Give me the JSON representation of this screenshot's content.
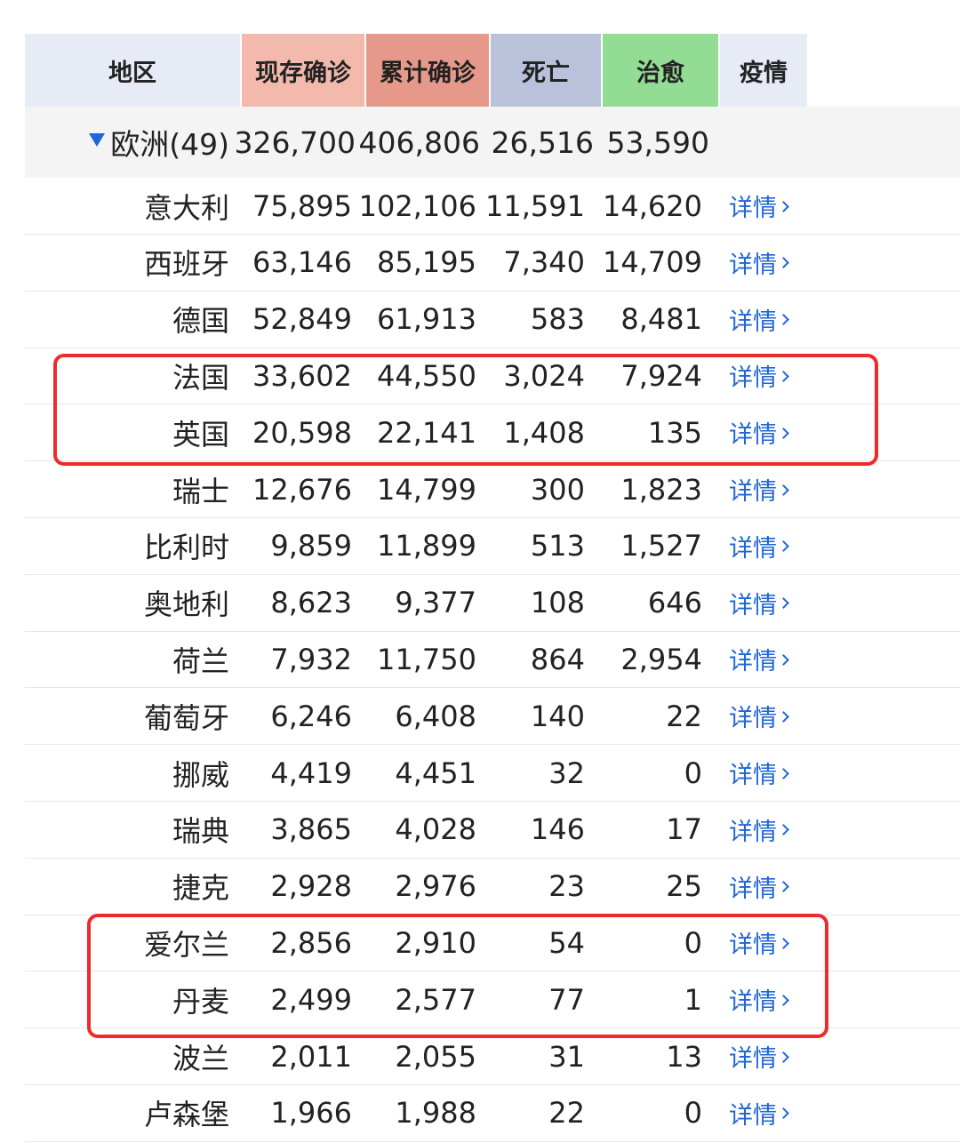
{
  "header": {
    "columns": [
      {
        "key": "region",
        "label": "地区",
        "color": "#e6ebf6"
      },
      {
        "key": "current",
        "label": "现存确诊",
        "color": "#f2b9ac"
      },
      {
        "key": "cumulative",
        "label": "累计确诊",
        "color": "#e6998a"
      },
      {
        "key": "deaths",
        "label": "死亡",
        "color": "#b9c2da"
      },
      {
        "key": "recovered",
        "label": "治愈",
        "color": "#93dc93"
      },
      {
        "key": "epidemic",
        "label": "疫情",
        "color": "#e6ebf6"
      }
    ]
  },
  "summary": {
    "name": "欧洲(49)",
    "current": "326,700",
    "cumulative": "406,806",
    "deaths": "26,516",
    "recovered": "53,590"
  },
  "detail_label": "详情",
  "rows": [
    {
      "name": "意大利",
      "current": "75,895",
      "cumulative": "102,106",
      "deaths": "11,591",
      "recovered": "14,620"
    },
    {
      "name": "西班牙",
      "current": "63,146",
      "cumulative": "85,195",
      "deaths": "7,340",
      "recovered": "14,709"
    },
    {
      "name": "德国",
      "current": "52,849",
      "cumulative": "61,913",
      "deaths": "583",
      "recovered": "8,481"
    },
    {
      "name": "法国",
      "current": "33,602",
      "cumulative": "44,550",
      "deaths": "3,024",
      "recovered": "7,924"
    },
    {
      "name": "英国",
      "current": "20,598",
      "cumulative": "22,141",
      "deaths": "1,408",
      "recovered": "135"
    },
    {
      "name": "瑞士",
      "current": "12,676",
      "cumulative": "14,799",
      "deaths": "300",
      "recovered": "1,823"
    },
    {
      "name": "比利时",
      "current": "9,859",
      "cumulative": "11,899",
      "deaths": "513",
      "recovered": "1,527"
    },
    {
      "name": "奥地利",
      "current": "8,623",
      "cumulative": "9,377",
      "deaths": "108",
      "recovered": "646"
    },
    {
      "name": "荷兰",
      "current": "7,932",
      "cumulative": "11,750",
      "deaths": "864",
      "recovered": "2,954"
    },
    {
      "name": "葡萄牙",
      "current": "6,246",
      "cumulative": "6,408",
      "deaths": "140",
      "recovered": "22"
    },
    {
      "name": "挪威",
      "current": "4,419",
      "cumulative": "4,451",
      "deaths": "32",
      "recovered": "0"
    },
    {
      "name": "瑞典",
      "current": "3,865",
      "cumulative": "4,028",
      "deaths": "146",
      "recovered": "17"
    },
    {
      "name": "捷克",
      "current": "2,928",
      "cumulative": "2,976",
      "deaths": "23",
      "recovered": "25"
    },
    {
      "name": "爱尔兰",
      "current": "2,856",
      "cumulative": "2,910",
      "deaths": "54",
      "recovered": "0"
    },
    {
      "name": "丹麦",
      "current": "2,499",
      "cumulative": "2,577",
      "deaths": "77",
      "recovered": "1"
    },
    {
      "name": "波兰",
      "current": "2,011",
      "cumulative": "2,055",
      "deaths": "31",
      "recovered": "13"
    },
    {
      "name": "卢森堡",
      "current": "1,966",
      "cumulative": "1,988",
      "deaths": "22",
      "recovered": "0"
    }
  ],
  "highlight_color": "#ef2a2a"
}
